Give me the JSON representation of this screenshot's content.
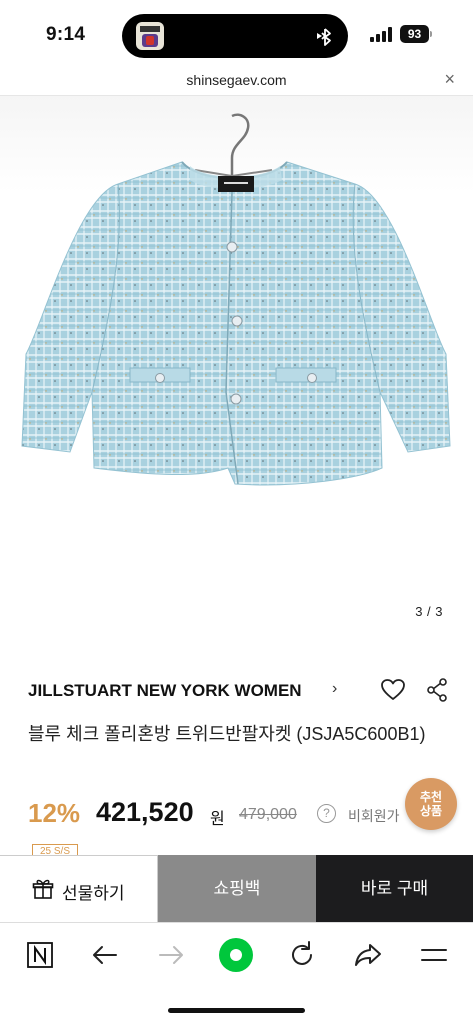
{
  "status_bar": {
    "time": "9:14",
    "battery": "93",
    "now_playing_art": "album-art-thumbnail"
  },
  "browser": {
    "url": "shinsegaev.com",
    "close_icon": "close-icon"
  },
  "gallery": {
    "counter": "3 / 3",
    "image": "light-blue tweed short-sleeve cropped jacket on hanger",
    "garment_color": "#a9d1df"
  },
  "product": {
    "brand": "JILLSTUART NEW YORK WOMEN",
    "brand_chevron": "›",
    "title": "블루 체크 폴리혼방 트위드반팔자켓 (JSJA5C600B1)",
    "discount": "12%",
    "price": "421,520",
    "currency": "원",
    "original_price": "479,000",
    "help_glyph": "?",
    "member_price_label": "비회원가",
    "season_badge": "25 S/S"
  },
  "recommend_fab": {
    "line1": "추천",
    "line2": "상품"
  },
  "actions": {
    "gift_label": "선물하기",
    "bag_label": "쇼핑백",
    "buy_label": "바로 구매"
  },
  "toolbar": {
    "items": [
      "naver-n-icon",
      "back-arrow-icon",
      "forward-arrow-icon",
      "green-dot-icon",
      "refresh-icon",
      "share-arrow-icon",
      "menu-icon"
    ]
  },
  "colors": {
    "accent": "#d99a4e",
    "bag_button": "#8a8a8a",
    "buy_button": "#1c1c1e",
    "green": "#00c73c"
  }
}
